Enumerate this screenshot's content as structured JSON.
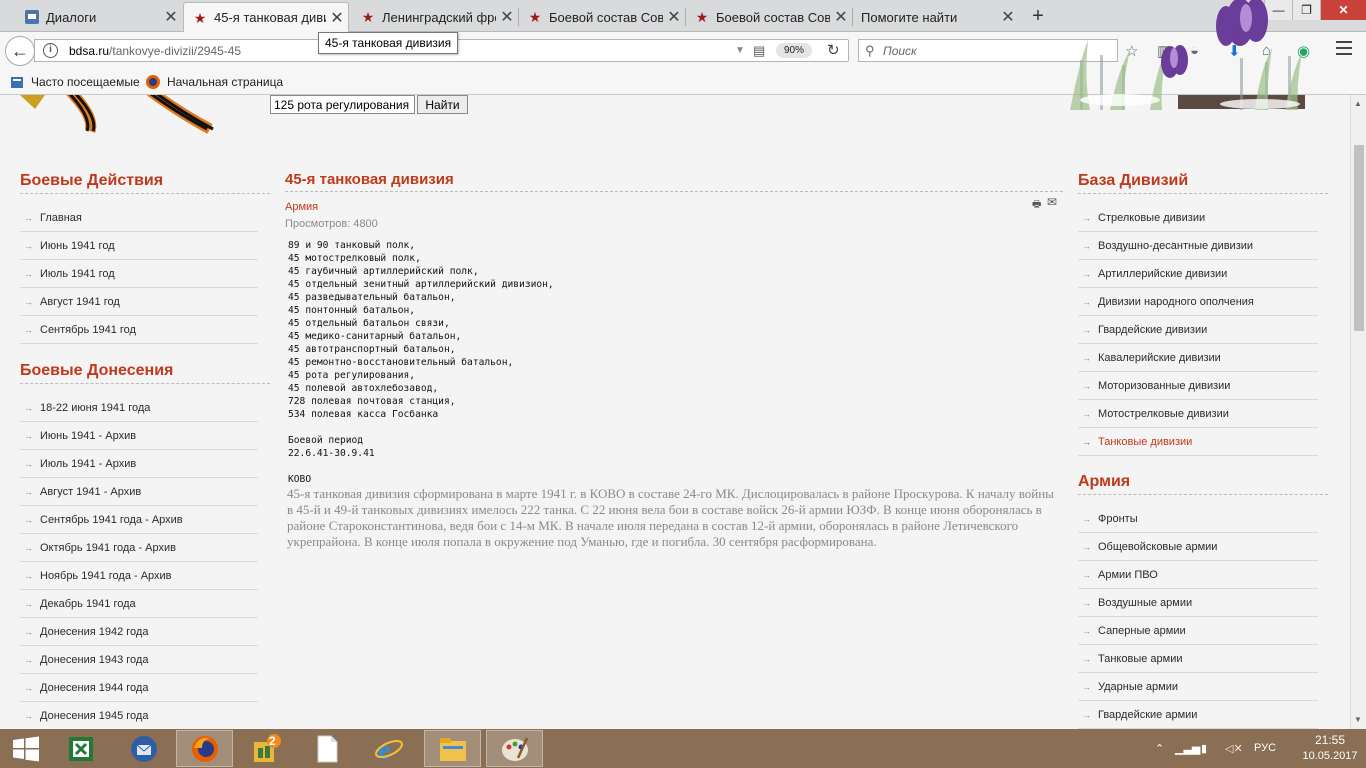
{
  "browser": {
    "tabs": [
      {
        "label": "Диалоги",
        "icon": "dialog-icon",
        "active": false
      },
      {
        "label": "45-я танковая дивизия",
        "icon": "red-star-icon",
        "active": true
      },
      {
        "label": "Ленинградский фронт",
        "icon": "red-star-icon",
        "active": false
      },
      {
        "label": "Боевой состав Советской армии",
        "icon": "red-star-icon",
        "active": false
      },
      {
        "label": "Боевой состав Советской армии",
        "icon": "red-star-icon",
        "active": false
      },
      {
        "label": "Помогите найти",
        "icon": "",
        "active": false
      }
    ],
    "url_host": "bdsa.ru",
    "url_path": "/tankovye-divizii/2945-45",
    "zoom": "90%",
    "search_placeholder": "Поиск",
    "tooltip": "45-я танковая дивизия",
    "bookmarks": [
      "Часто посещаемые",
      "Начальная страница"
    ]
  },
  "page": {
    "search_value": "125 рота регулирования",
    "search_button": "Найти",
    "left_modules": [
      {
        "title": "Боевые Действия",
        "items": [
          "Главная",
          "Июнь 1941 год",
          "Июль 1941 год",
          "Август 1941 год",
          "Сентябрь 1941 год"
        ]
      },
      {
        "title": "Боевые Донесения",
        "items": [
          "18-22 июня 1941 года",
          "Июнь 1941 - Архив",
          "Июль 1941 - Архив",
          "Август 1941 - Архив",
          "Сентябрь 1941 года - Архив",
          "Октябрь 1941 года - Архив",
          "Ноябрь 1941 года - Архив",
          "Декабрь 1941 года",
          "Донесения 1942 года",
          "Донесения 1943 года",
          "Донесения 1944 года",
          "Донесения 1945 года"
        ]
      }
    ],
    "right_modules": [
      {
        "title": "База Дивизий",
        "items": [
          "Стрелковые дивизии",
          "Воздушно-десантные дивизии",
          "Артиллерийские дивизии",
          "Дивизии народного ополчения",
          "Гвардейские дивизии",
          "Кавалерийские дивизии",
          "Моторизованные дивизии",
          "Мотострелковые дивизии",
          "Танковые дивизии"
        ],
        "current_index": 8
      },
      {
        "title": "Армия",
        "items": [
          "Фронты",
          "Общевойсковые армии",
          "Армии ПВО",
          "Воздушные армии",
          "Саперные армии",
          "Танковые армии",
          "Ударные армии",
          "Гвардейские армии"
        ]
      }
    ],
    "article": {
      "title": "45-я танковая дивизия",
      "category": "Армия",
      "views": "Просмотров: 4800",
      "units": "89 и 90 танковый полк,\n45 мотострелковый полк,\n45 гаубичный артиллерийский полк,\n45 отдельный зенитный артиллерийский дивизион,\n45 разведывательный батальон,\n45 понтонный батальон,\n45 отдельный батальон связи,\n45 медико-санитарный батальон,\n45 автотранспортный батальон,\n45 ремонтно-восстановительный батальон,\n45 рота регулирования,\n45 полевой автохлебозавод,\n728 полевая почтовая станция,\n534 полевая касса Госбанка\n\nБоевой период\n22.6.41-30.9.41\n\nКОВО",
      "description": "45-я танковая дивизия сформирована в марте 1941 г. в КОВО в составе 24-го МК. Дислоцировалась в районе Проскурова. К началу войны в 45-й и 49-й танковых дивизиях имелось 222 танка. С 22 июня вела бои в составе войск 26-й армии ЮЗФ. В конце июня оборонялась в районе Староконстантинова, ведя бои с 14-м МК. В начале июля передана в состав 12-й армии, оборонялась в районе Летичевского укрепрайона. В конце июля попала в окружение под Уманью, где и погибла. 30 сентября расформирована."
    }
  },
  "taskbar": {
    "apps": [
      "start-button",
      "excel-icon",
      "thunderbird-icon",
      "firefox-icon",
      "apps-badge-icon",
      "document-icon",
      "internet-explorer-icon",
      "file-explorer-icon",
      "paint-icon"
    ],
    "badge": "2",
    "language": "РУС",
    "time": "21:55",
    "date": "10.05.2017"
  }
}
